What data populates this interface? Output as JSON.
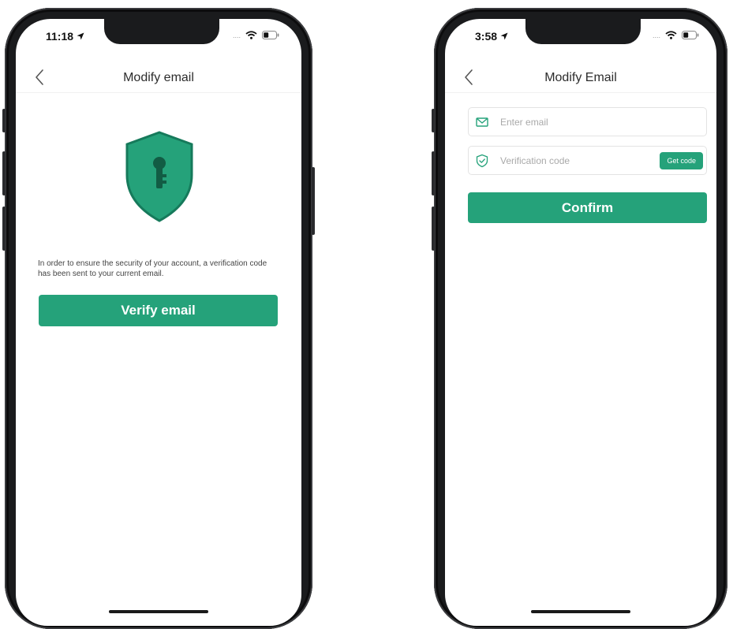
{
  "colors": {
    "accent": "#25a27a",
    "shield_fill": "#25a27a",
    "shield_stroke": "#167a5b",
    "frame": "#1a1b1d"
  },
  "left_screen": {
    "status_time": "11:18",
    "nav_title": "Modify email",
    "back_icon": "chevron-left-icon",
    "shield_icon": "shield-key-icon",
    "info_text": "In order to ensure the security of your account, a verification code has been sent to your current email.",
    "verify_button": "Verify email"
  },
  "right_screen": {
    "status_time": "3:58",
    "nav_title": "Modify Email",
    "back_icon": "chevron-left-icon",
    "email_field": {
      "icon": "mail-icon",
      "placeholder": "Enter email",
      "value": ""
    },
    "code_field": {
      "icon": "shield-check-icon",
      "placeholder": "Verification code",
      "value": "",
      "get_code_label": "Get code"
    },
    "confirm_button": "Confirm"
  }
}
